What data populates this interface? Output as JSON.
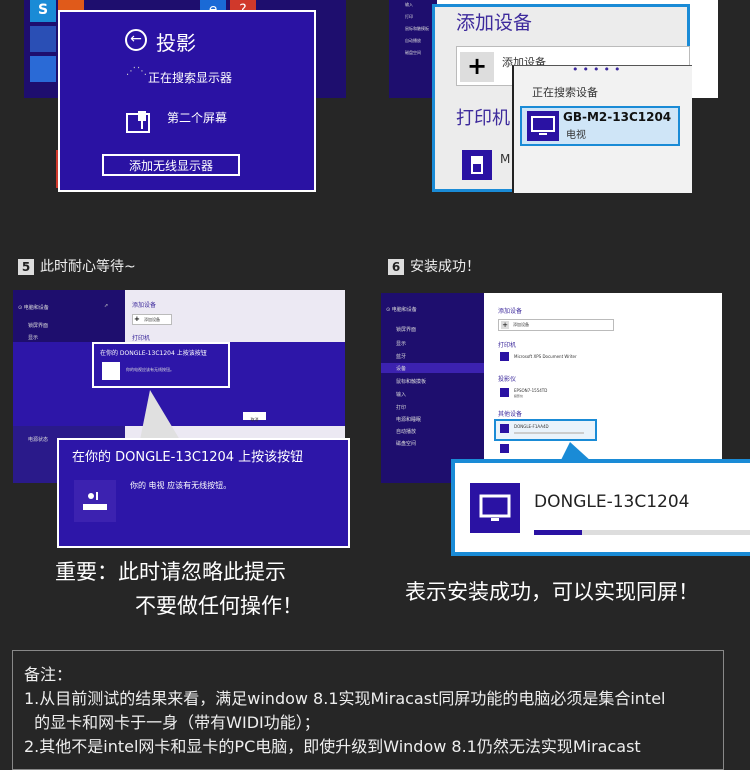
{
  "panel1": {
    "title": "投影",
    "searching": "正在搜索显示器",
    "second_screen": "第二个屏幕",
    "add_wireless": "添加无线显示器"
  },
  "panel2": {
    "sidebar_items": [
      "输入",
      "打印",
      "鼠标和触摸板",
      "自动播放",
      "磁盘空间"
    ],
    "heading": "添加设备",
    "add_device": "添加设备",
    "printer_heading": "打印机",
    "searching": "正在搜索设备",
    "device_name": "GB-M2-13C1204",
    "device_type": "电视",
    "printer_partial": "M"
  },
  "step5": {
    "number": "5",
    "label": "此时耐心等待~",
    "sidebar_title": "电脑和设备",
    "sidebar_items": [
      "锁屏界面",
      "显示",
      "蓝牙",
      "设备",
      "鼠标和触摸板",
      "输入",
      "打印",
      "电源和睡眠",
      "自动播放",
      "磁盘空间"
    ],
    "corner_item": "电源状态",
    "heading": "添加设备",
    "add_device": "添加设备",
    "printer_heading": "打印机",
    "small_prompt": "在你的 DONGLE-13C1204 上按该按钮",
    "small_prompt_desc": "你的电视应该有无线按钮。",
    "cancel": "取消",
    "big_prompt": "在你的 DONGLE-13C1204 上按该按钮",
    "big_prompt_desc": "你的 电视 应该有无线按钮。",
    "important_line1": "重要：此时请忽略此提示",
    "important_line2": "不要做任何操作！"
  },
  "step6": {
    "number": "6",
    "label": "安装成功！",
    "sidebar_title": "电脑和设备",
    "sidebar_items": [
      "锁屏界面",
      "显示",
      "蓝牙",
      "设备",
      "鼠标和触摸板",
      "输入",
      "打印",
      "电源和睡眠",
      "自动播放",
      "磁盘空间"
    ],
    "heading": "添加设备",
    "add_device": "添加设备",
    "printer_heading": "打印机",
    "printer_item": "Microsoft XPS Document Writer",
    "projector_heading": "投影仪",
    "projector_item": "EPSON7-1554TD",
    "projector_sub": "投影仪",
    "other_heading": "其他设备",
    "other_item": "DONGLE-F1AA4D",
    "device_name": "DONGLE-13C1204",
    "progress": 0.22,
    "success_text": "表示安装成功，可以实现同屏！"
  },
  "notes": {
    "title": "备注：",
    "line1": "1.从目前测试的结果来看，满足window 8.1实现Miracast同屏功能的电脑必须是集合intel",
    "line2": "  的显卡和网卡于一身（带有WIDI功能）；",
    "line3": "2.其他不是intel网卡和显卡的PC电脑，即使升级到Window 8.1仍然无法实现Miracast"
  },
  "colors": {
    "win_purple": "#1e0e6e",
    "accent_blue": "#1a8bd6",
    "tile_red": "#d0392b"
  }
}
